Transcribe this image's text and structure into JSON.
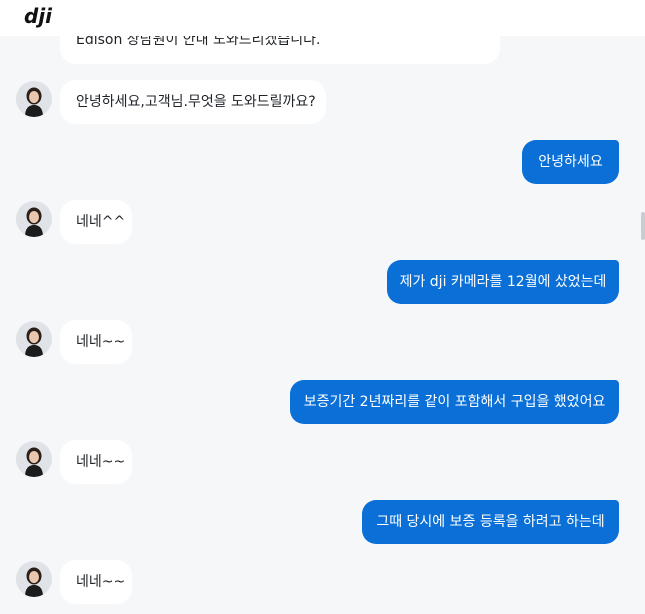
{
  "header": {
    "logo_text": "dji"
  },
  "messages": [
    {
      "from": "agent",
      "text": "Edison 상담원이 안내 도와드리겠습니다.",
      "avatar": "agent-avatar"
    },
    {
      "from": "agent",
      "text": "안녕하세요,고객님.무엇을 도와드릴까요?",
      "avatar": "agent-avatar"
    },
    {
      "from": "user",
      "text": "안녕하세요"
    },
    {
      "from": "agent",
      "text": "네네^^",
      "avatar": "agent-avatar"
    },
    {
      "from": "user",
      "text": "제가 dji 카메라를 12월에 샀었는데"
    },
    {
      "from": "agent",
      "text": "네네~~",
      "avatar": "agent-avatar"
    },
    {
      "from": "user",
      "text": "보증기간 2년짜리를 같이 포함해서 구입을 했었어요"
    },
    {
      "from": "agent",
      "text": "네네~~",
      "avatar": "agent-avatar"
    },
    {
      "from": "user",
      "text": "그때 당시에 보증 등록을 하려고 하는데"
    },
    {
      "from": "agent",
      "text": "네네~~",
      "avatar": "agent-avatar"
    }
  ],
  "colors": {
    "user_bubble": "#0a6fd6",
    "agent_bubble": "#ffffff",
    "background": "#f6f7f9"
  }
}
